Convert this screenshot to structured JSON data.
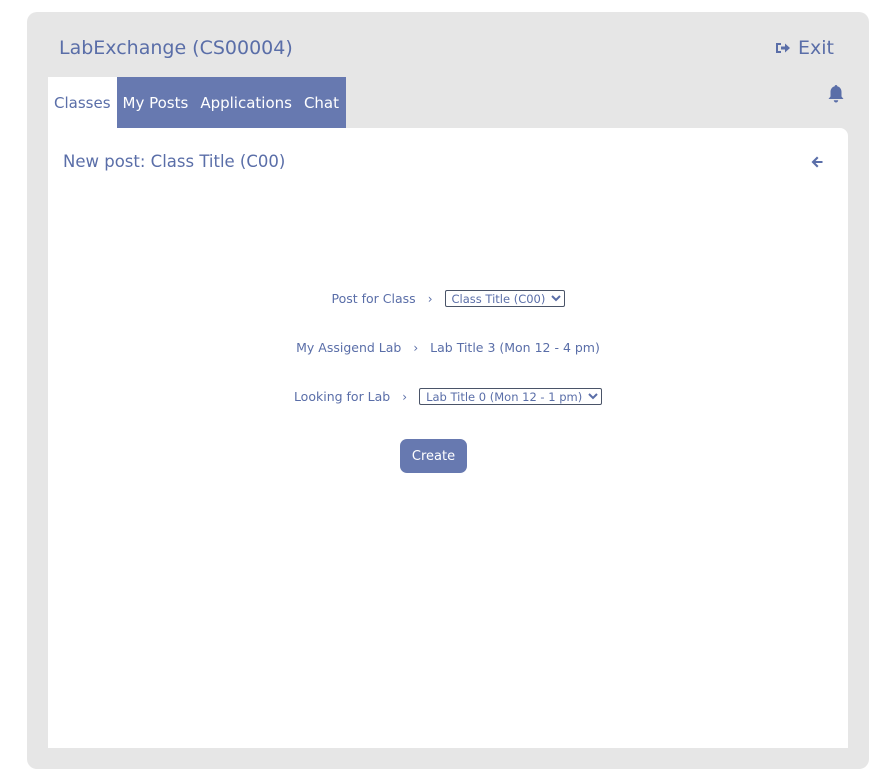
{
  "app": {
    "title": "LabExchange (CS00004)",
    "exit_label": "Exit"
  },
  "tabs": [
    {
      "label": "Classes",
      "active": true
    },
    {
      "label": "My Posts",
      "active": false
    },
    {
      "label": "Applications",
      "active": false
    },
    {
      "label": "Chat",
      "active": false
    }
  ],
  "icons": {
    "exit": "sign-out-icon",
    "notifications": "bell-icon",
    "back": "arrow-left-icon"
  },
  "post": {
    "title": "New post: Class Title (C00)",
    "fields": {
      "class": {
        "label": "Post for Class",
        "selected": "Class Title (C00)"
      },
      "assigned_lab": {
        "label": "My Assigend Lab",
        "value": "Lab Title 3 (Mon 12 - 4 pm)"
      },
      "looking_for": {
        "label": "Looking for Lab",
        "selected": "Lab Title 0 (Mon 12 - 1 pm)"
      }
    },
    "separator": "›",
    "create_label": "Create"
  },
  "colors": {
    "accent": "#6779b0",
    "text": "#5a6ea8",
    "frame": "#e6e6e6"
  }
}
